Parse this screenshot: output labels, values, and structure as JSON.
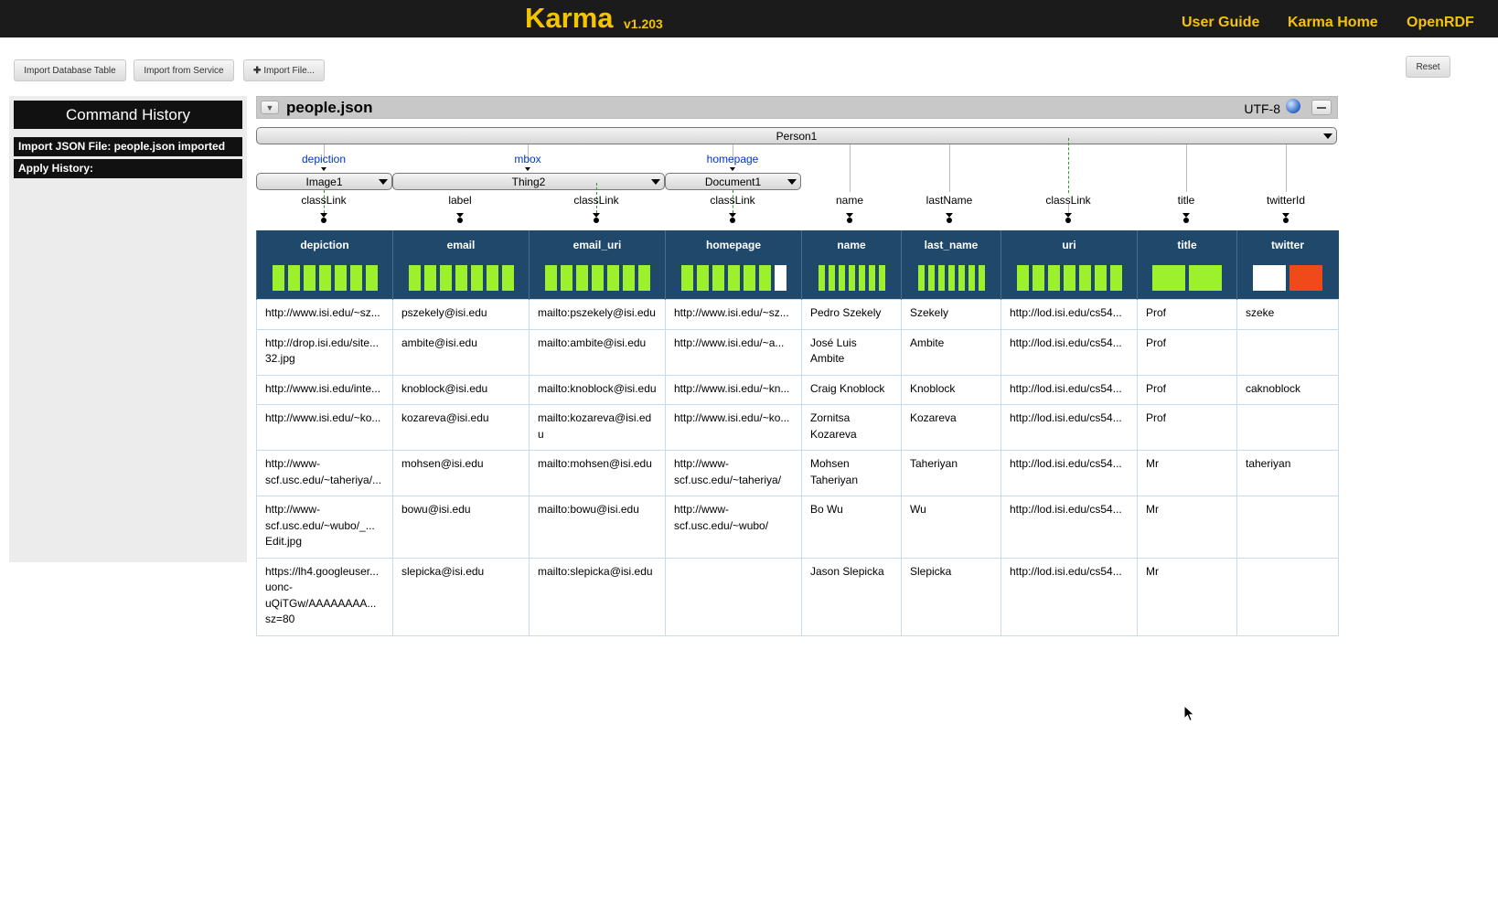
{
  "app": {
    "name": "Karma",
    "version": "v1.203"
  },
  "nav": {
    "user_guide": "User Guide",
    "karma_home": "Karma Home",
    "openrdf": "OpenRDF"
  },
  "toolbar": {
    "import_db": "Import Database Table",
    "import_service": "Import from Service",
    "import_file": "Import File...",
    "reset": "Reset"
  },
  "command_history": {
    "title": "Command History",
    "items": [
      "Import JSON File: people.json imported",
      "Apply History:"
    ]
  },
  "worksheet": {
    "title": "people.json",
    "encoding": "UTF-8",
    "root_node": "Person1",
    "nodes": [
      {
        "label": "Image1",
        "link": "depiction"
      },
      {
        "label": "Thing2",
        "link": "mbox"
      },
      {
        "label": "Document1",
        "link": "homepage"
      }
    ],
    "properties": [
      "classLink",
      "label",
      "classLink",
      "classLink",
      "name",
      "lastName",
      "classLink",
      "title",
      "twitterId"
    ],
    "columns": [
      {
        "name": "depiction",
        "bars": "7g"
      },
      {
        "name": "email",
        "bars": "7g"
      },
      {
        "name": "email_uri",
        "bars": "7g"
      },
      {
        "name": "homepage",
        "bars": "6g1w"
      },
      {
        "name": "name",
        "bars": "7n"
      },
      {
        "name": "last_name",
        "bars": "7n"
      },
      {
        "name": "uri",
        "bars": "7g"
      },
      {
        "name": "title",
        "bars": "2g"
      },
      {
        "name": "twitter",
        "bars": "wr"
      }
    ],
    "rows": [
      [
        "http://www.isi.edu/~sz...",
        "pszekely@isi.edu",
        "mailto:pszekely@isi.edu",
        "http://www.isi.edu/~sz...",
        "Pedro Szekely",
        "Szekely",
        "http://lod.isi.edu/cs54...",
        "Prof",
        "szeke"
      ],
      [
        "http://drop.isi.edu/site...\n32.jpg",
        "ambite@isi.edu",
        "mailto:ambite@isi.edu",
        "http://www.isi.edu/~a...",
        "José Luis\nAmbite",
        "Ambite",
        "http://lod.isi.edu/cs54...",
        "Prof",
        ""
      ],
      [
        "http://www.isi.edu/inte...",
        "knoblock@isi.edu",
        "mailto:knoblock@isi.edu",
        "http://www.isi.edu/~kn...",
        "Craig Knoblock",
        "Knoblock",
        "http://lod.isi.edu/cs54...",
        "Prof",
        "caknoblock"
      ],
      [
        "http://www.isi.edu/~ko...",
        "kozareva@isi.edu",
        "mailto:kozareva@isi.edu",
        "http://www.isi.edu/~ko...",
        "Zornitsa\nKozareva",
        "Kozareva",
        "http://lod.isi.edu/cs54...",
        "Prof",
        ""
      ],
      [
        "http://www-\nscf.usc.edu/~taheriya/...",
        "mohsen@isi.edu",
        "mailto:mohsen@isi.edu",
        "http://www-\nscf.usc.edu/~taheriya/",
        "Mohsen\nTaheriyan",
        "Taheriyan",
        "http://lod.isi.edu/cs54...",
        "Mr",
        "taheriyan"
      ],
      [
        "http://www-\nscf.usc.edu/~wubo/_...\nEdit.jpg",
        "bowu@isi.edu",
        "mailto:bowu@isi.edu",
        "http://www-\nscf.usc.edu/~wubo/",
        "Bo Wu",
        "Wu",
        "http://lod.isi.edu/cs54...",
        "Mr",
        ""
      ],
      [
        "https://lh4.googleuser...\nuonc-\nuQiTGw/AAAAAAAA...\nsz=80",
        "slepicka@isi.edu",
        "mailto:slepicka@isi.edu",
        "",
        "Jason Slepicka",
        "Slepicka",
        "http://lod.isi.edu/cs54...",
        "Mr",
        ""
      ]
    ]
  },
  "colors": {
    "topbar": "#1b1b1b",
    "brand": "#f5c400",
    "header": "#20486a",
    "bar_green": "#9cf02c",
    "bar_red": "#f04a1a",
    "link_blue": "#0033cc"
  }
}
